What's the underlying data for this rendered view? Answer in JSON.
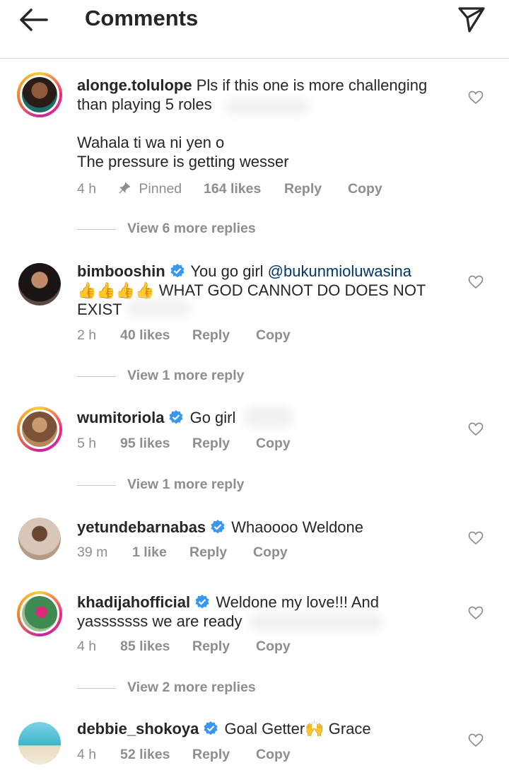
{
  "header": {
    "title": "Comments"
  },
  "comments": [
    {
      "username": "alonge.tolulope",
      "verified": false,
      "text_line1": "Pls if this one is more challenging",
      "text_line2": "than playing 5 roles",
      "text_line3": "Wahala ti wa ni yen o",
      "text_line4": "The pressure is getting wesser",
      "time": "4 h",
      "pinned": "Pinned",
      "likes": "164 likes",
      "reply": "Reply",
      "copy": "Copy",
      "view_more": "View 6 more replies"
    },
    {
      "username": "bimbooshin",
      "verified": true,
      "text_pre": "You go girl ",
      "mention": "@bukunmioluwasina",
      "emoji": "👍👍👍👍",
      "text_line2": " WHAT GOD CANNOT DO DOES NOT",
      "text_line3": "EXIST",
      "time": "2 h",
      "likes": "40 likes",
      "reply": "Reply",
      "copy": "Copy",
      "view_more": "View 1 more reply"
    },
    {
      "username": "wumitoriola",
      "verified": true,
      "text": "Go girl",
      "time": "5 h",
      "likes": "95 likes",
      "reply": "Reply",
      "copy": "Copy",
      "view_more": "View 1 more reply"
    },
    {
      "username": "yetundebarnabas",
      "verified": true,
      "text": "Whaoooo Weldone",
      "time": "39 m",
      "likes": "1 like",
      "reply": "Reply",
      "copy": "Copy"
    },
    {
      "username": "khadijahofficial",
      "verified": true,
      "text_line1": "Weldone my love!!! And",
      "text_line2": "yasssssss we are ready",
      "time": "4 h",
      "likes": "85 likes",
      "reply": "Reply",
      "copy": "Copy",
      "view_more": "View 2 more replies"
    },
    {
      "username": "debbie_shokoya",
      "verified": true,
      "text_pre": "Goal Getter",
      "emoji": "🙌",
      "text_post": " Grace",
      "time": "4 h",
      "likes": "52 likes",
      "reply": "Reply",
      "copy": "Copy"
    }
  ],
  "icons": {
    "back": "arrow-left-icon",
    "send": "paper-plane-icon",
    "like": "heart-outline-icon",
    "pin": "pushpin-icon",
    "verified": "verified-badge-icon"
  },
  "colors": {
    "verified": "#3897f0",
    "mention": "#00376b",
    "muted": "#8e8e8e",
    "ring_start": "#f9ce34",
    "ring_mid": "#ee2a7b"
  }
}
